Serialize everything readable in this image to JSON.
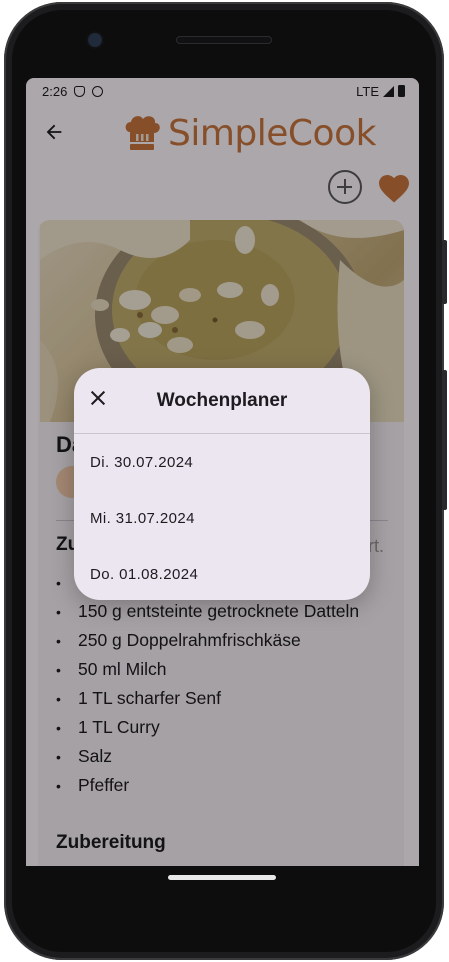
{
  "status": {
    "time": "2:26",
    "network": "LTE"
  },
  "app": {
    "name": "SimpleCook",
    "brand_color": "#c8743f"
  },
  "icons": {
    "back": "back-arrow-icon",
    "add": "add-circle-icon",
    "favorite": "heart-icon",
    "close": "close-icon"
  },
  "recipe": {
    "title_visible": "Da",
    "ingredients_head_visible": "Zu",
    "ingredients_aside_visible": "rt.",
    "ingredients": [
      "150 g entsteinte getrocknete Datteln",
      "250 g Doppelrahmfrischkäse",
      "50 ml Milch",
      "1 TL scharfer Senf",
      "1 TL Curry",
      "Salz",
      "Pfeffer"
    ],
    "preparation_head": "Zubereitung"
  },
  "dialog": {
    "title": "Wochenplaner",
    "dates": [
      "Di. 30.07.2024",
      "Mi. 31.07.2024",
      "Do. 01.08.2024"
    ]
  }
}
